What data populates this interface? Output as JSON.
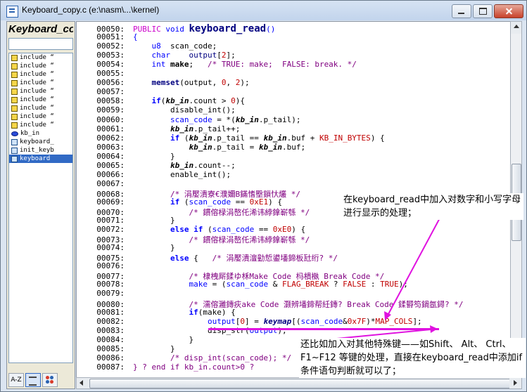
{
  "window": {
    "title": "Keyboard_copy.c (e:\\nasm\\...\\kernel)"
  },
  "symbol_panel": {
    "title": "Keyboard_co",
    "search_value": "",
    "items": [
      {
        "icon": "hash-icon",
        "label": "include “",
        "selected": false
      },
      {
        "icon": "hash-icon",
        "label": "include “",
        "selected": false
      },
      {
        "icon": "hash-icon",
        "label": "include “",
        "selected": false
      },
      {
        "icon": "hash-icon",
        "label": "include “",
        "selected": false
      },
      {
        "icon": "hash-icon",
        "label": "include “",
        "selected": false
      },
      {
        "icon": "hash-icon",
        "label": "include “",
        "selected": false
      },
      {
        "icon": "hash-icon",
        "label": "include “",
        "selected": false
      },
      {
        "icon": "hash-icon",
        "label": "include “",
        "selected": false
      },
      {
        "icon": "hash-icon",
        "label": "include “",
        "selected": false
      },
      {
        "icon": "ellipse-icon",
        "label": "kb_in",
        "selected": false
      },
      {
        "icon": "function-icon",
        "label": "keyboard_",
        "selected": false
      },
      {
        "icon": "function-icon",
        "label": "init_keyb",
        "selected": false
      },
      {
        "icon": "function-icon",
        "label": "keyboard",
        "selected": true
      }
    ],
    "toolbar": {
      "sort_az": "A-Z"
    }
  },
  "code": [
    {
      "no": "00050:",
      "html": "<span class='kw2'>PUBLIC</span> <span class='kw'>void</span> <span class='big'>keyboard_read</span><span class='kw'>()</span>"
    },
    {
      "no": "00051:",
      "html": "<span class='kw'>{</span>"
    },
    {
      "no": "00052:",
      "html": "    <span class='kw'>u8</span>  scan_code;"
    },
    {
      "no": "00053:",
      "html": "    <span class='kw'>char</span>    <span class='fn'>output</span>[<span class='red'>2</span>];"
    },
    {
      "no": "00054:",
      "html": "    <span class='kw'>int</span> <b>make</b>;   <span class='cmt'>/* TRUE: make;  FALSE: break. */</span>"
    },
    {
      "no": "00055:",
      "html": ""
    },
    {
      "no": "00056:",
      "html": "    <b class='fn'>memset</b>(output, <span class='red'>0</span>, <span class='red'>2</span>);"
    },
    {
      "no": "00057:",
      "html": ""
    },
    {
      "no": "00058:",
      "html": "    <b class='kw'>if</b>(<b><i>kb_in</i></b>.count &gt; <span class='red'>0</span>){"
    },
    {
      "no": "00059:",
      "html": "        disable_int();"
    },
    {
      "no": "00060:",
      "html": "        <span class='kw'>scan_code</span> = *(<b><i>kb_in</i></b>.p_tail);"
    },
    {
      "no": "00061:",
      "html": "        <b><i>kb_in</i></b>.p_tail++;"
    },
    {
      "no": "00062:",
      "html": "        <b class='kw'>if</b> (<b><i>kb_in</i></b>.p_tail == <b><i>kb_in</i></b>.buf + <span class='red'>KB_IN_BYTES</span>) {"
    },
    {
      "no": "00063:",
      "html": "            <b><i>kb_in</i></b>.p_tail = <b><i>kb_in</i></b>.buf;"
    },
    {
      "no": "00064:",
      "html": "        }"
    },
    {
      "no": "00065:",
      "html": "        <b><i>kb_in</i></b>.count--;"
    },
    {
      "no": "00066:",
      "html": "        enable_int();"
    },
    {
      "no": "00067:",
      "html": ""
    },
    {
      "no": "00068:",
      "html": "        <span class='cmt'>/* 涓嬮潰寮€濮嬭В鏋愭壂鎻忕爜 */</span>"
    },
    {
      "no": "00069:",
      "html": "        <b class='kw'>if</b> (<span class='kw'>scan_code</span> == <span class='red'>0xE1</span>) {"
    },
    {
      "no": "00070:",
      "html": "            <span class='cmt'>/* 鏆傛椂涓嶅仛浠讳綍鎿嶄綔 */</span>"
    },
    {
      "no": "00071:",
      "html": "        }"
    },
    {
      "no": "00072:",
      "html": "        <b class='kw'>else if</b> (<span class='kw'>scan_code</span> == <span class='red'>0xE0</span>) {"
    },
    {
      "no": "00073:",
      "html": "            <span class='cmt'>/* 鏆傛椂涓嶅仛浠讳綍鎿嶄綔 */</span>"
    },
    {
      "no": "00074:",
      "html": "        }"
    },
    {
      "no": "00075:",
      "html": "        <b class='kw'>else</b> {   <span class='cmt'>/* 涓嬮潰澶勭悊鍙墦鍗板瓧绗? */</span>"
    },
    {
      "no": "00076:",
      "html": ""
    },
    {
      "no": "00077:",
      "html": "            <span class='cmt'>/* 棣栧厛鍒ゆ柇Make Code 杩樻槸 Break Code */</span>"
    },
    {
      "no": "00078:",
      "html": "            <span class='kw'>make</span> = (<span class='kw'>scan_code</span> &amp; <span class='red'>FLAG_BREAK</span> ? <span class='red'>FALSE</span> : <span class='red'>TRUE</span>);"
    },
    {
      "no": "00079:",
      "html": ""
    },
    {
      "no": "00080:",
      "html": "            <span class='cmt'>/* 濡傛灉鏄疢ake Code 灏辨墦鍗帮紝鏄? Break Code 鍒欎笉鍋氬鐞? */</span>"
    },
    {
      "no": "00081:",
      "html": "            <b class='kw'>if</b>(make) {"
    },
    {
      "no": "00082:",
      "html": "                <span class='kw'>output</span>[<span class='red'>0</span>] = <b><i class='fn'>keymap</i></b>[(<span class='kw'>scan_code</span>&amp;<span class='red'>0x7F</span>)*<span class='red'>MAP_COLS</span>];"
    },
    {
      "no": "00083:",
      "html": "                disp_str(<span class='kw'>output</span>);"
    },
    {
      "no": "00084:",
      "html": "            }"
    },
    {
      "no": "00085:",
      "html": "        }"
    },
    {
      "no": "00086:",
      "html": "        <span class='cmt'>/* disp_int(scan_code); */</span>"
    },
    {
      "no": "00087:",
      "html": "<span class='cmt'>} ? end if kb_in.count&gt;0 ?</span>"
    }
  ],
  "annotations": {
    "note1": "在keyboard_read中加入对数字和小写字母进行显示的处理；",
    "note2": "还比如加入对其他特殊键——如Shift、 Alt、 Ctrl、 F1~F12 等键的处理，直接在keyboard_read中添加if 条件语句判断就可以了；"
  },
  "colors": {
    "arrow": "#e012e0",
    "selection": "#316ac5"
  }
}
